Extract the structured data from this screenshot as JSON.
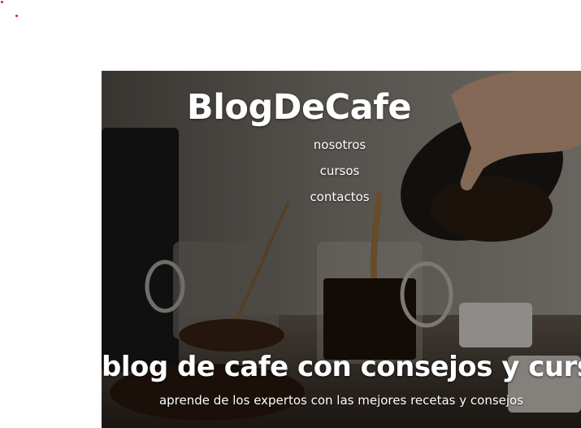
{
  "header": {
    "brand": "BlogDeCafe"
  },
  "nav": {
    "items": [
      {
        "label": "nosotros"
      },
      {
        "label": "cursos"
      },
      {
        "label": "contactos"
      }
    ]
  },
  "hero": {
    "headline": "blog de cafe con consejos y cursos",
    "subline": "aprende de los expertos con las mejores recetas y consejos",
    "image": "coffee-pour-photo"
  },
  "colors": {
    "accent_dots": "#d8232a",
    "text": "#ffffff"
  }
}
